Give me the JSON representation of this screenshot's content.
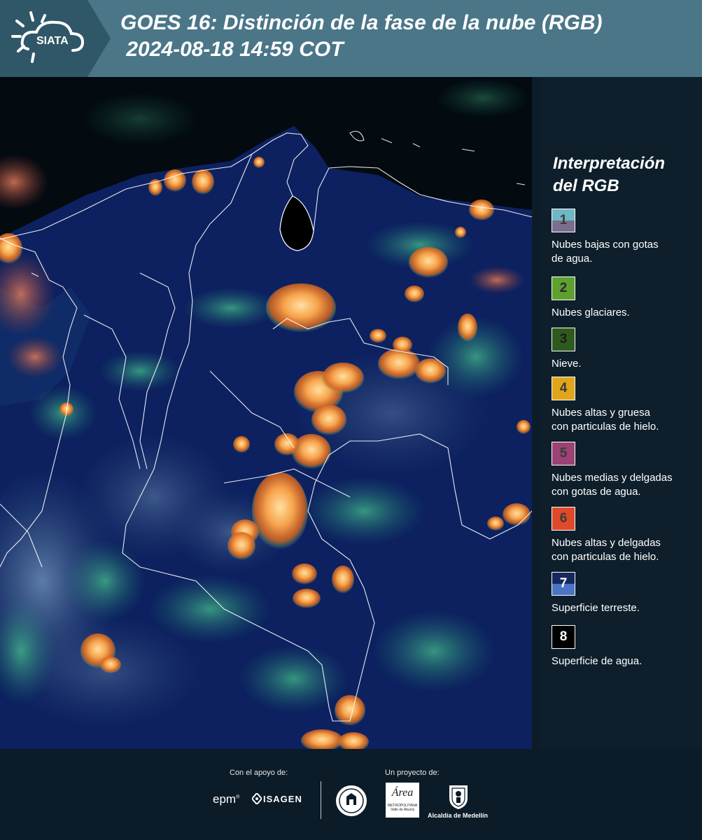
{
  "header": {
    "logo_text": "SIATA",
    "title_line1": "GOES 16: Distinción de la fase de la nube (RGB)",
    "title_line2": " 2024-08-18 14:59 COT"
  },
  "legend": {
    "title_line1": "Interpretación",
    "title_line2": "del RGB",
    "items": [
      {
        "number": "1",
        "label_line1": "Nubes bajas con gotas",
        "label_line2": "de agua.",
        "color_top": "#6fb7c4",
        "color_bottom": "#7a6f8f",
        "number_color": "#3b3b3b"
      },
      {
        "number": "2",
        "label_line1": "Nubes glaciares.",
        "label_line2": "",
        "color_top": "#5ea12f",
        "color_bottom": "#5ea12f",
        "number_color": "#2a2a2a"
      },
      {
        "number": "3",
        "label_line1": "Nieve.",
        "label_line2": "",
        "color_top": "#2f5a1d",
        "color_bottom": "#2f5a1d",
        "number_color": "#1a1a1a"
      },
      {
        "number": "4",
        "label_line1": "Nubes altas y gruesa",
        "label_line2": "con particulas de hielo.",
        "color_top": "#e0a51b",
        "color_bottom": "#e0a51b",
        "number_color": "#3b3b3b"
      },
      {
        "number": "5",
        "label_line1": "Nubes medias y delgadas",
        "label_line2": "con gotas de agua.",
        "color_top": "#9c4274",
        "color_bottom": "#9c4274",
        "number_color": "#3b3b3b"
      },
      {
        "number": "6",
        "label_line1": "Nubes altas y delgadas",
        "label_line2": "con particulas de hielo.",
        "color_top": "#e04a2a",
        "color_bottom": "#e04a2a",
        "number_color": "#3b3b3b"
      },
      {
        "number": "7",
        "label_line1": "Superficie terreste.",
        "label_line2": "",
        "color_top": "#16275e",
        "color_bottom": "#4a74c4",
        "number_color": "#ffffff"
      },
      {
        "number": "8",
        "label_line1": "Superficie de agua.",
        "label_line2": "",
        "color_top": "#000000",
        "color_bottom": "#000000",
        "number_color": "#ffffff"
      }
    ]
  },
  "footer": {
    "support_label": "Con el apoyo de:",
    "project_label": "Un proyecto de:",
    "epm": "epm",
    "isagen": "ISAGEN",
    "area_text": "Área",
    "area_sub1": "METROPOLITANA",
    "area_sub2": "Valle de Aburrá",
    "alcaldia": "Alcaldía de Medellín"
  },
  "colors": {
    "header_bg": "#4a7688",
    "logo_bg": "#2f5767",
    "legend_bg": "#0e1f2b",
    "footer_bg": "#0b1b27",
    "cloud_orange": "#f0a040",
    "cloud_green": "#3fc08a",
    "land_dark_blue": "#0d2160"
  }
}
